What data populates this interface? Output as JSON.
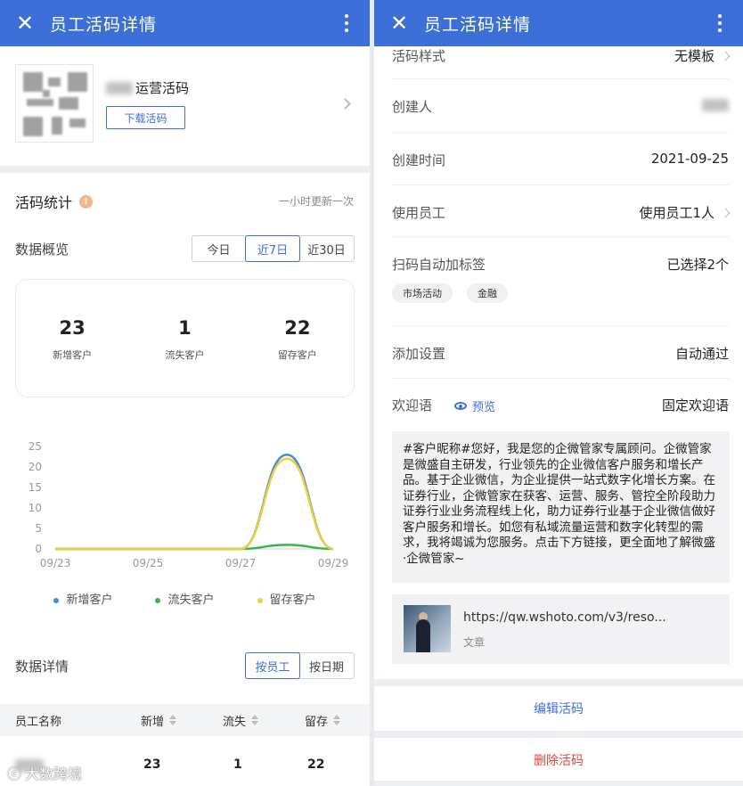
{
  "left": {
    "header": {
      "title": "员工活码详情",
      "close_glyph": "✕"
    },
    "code": {
      "name": "运营活码",
      "download_label": "下载活码"
    },
    "stats": {
      "title": "活码统计",
      "info_glyph": "!",
      "update_note": "一小时更新一次",
      "overview_label": "数据概览",
      "ranges": [
        "今日",
        "近7日",
        "近30日"
      ],
      "active_range": "近7日",
      "metrics": [
        {
          "value": "23",
          "label": "新增客户"
        },
        {
          "value": "1",
          "label": "流失客户"
        },
        {
          "value": "22",
          "label": "留存客户"
        }
      ]
    },
    "chart_data": {
      "type": "line",
      "x": [
        "09/23",
        "09/24",
        "09/25",
        "09/26",
        "09/27",
        "09/28",
        "09/29"
      ],
      "x_tick_labels": [
        "09/23",
        "09/25",
        "09/27",
        "09/29"
      ],
      "yticks": [
        0,
        5,
        10,
        15,
        20,
        25
      ],
      "ylim": [
        0,
        25
      ],
      "smooth": true,
      "series": [
        {
          "name": "新增客户",
          "color": "#3c8fdb",
          "values": [
            0,
            0,
            0,
            0,
            0,
            23,
            0
          ]
        },
        {
          "name": "流失客户",
          "color": "#3ab54a",
          "values": [
            0,
            0,
            0,
            0,
            0,
            1,
            0
          ]
        },
        {
          "name": "留存客户",
          "color": "#f2cc3a",
          "values": [
            0,
            0,
            0,
            0,
            0,
            22,
            0
          ]
        }
      ],
      "legend_position": "bottom"
    },
    "detail": {
      "label": "数据详情",
      "tabs": [
        "按员工",
        "按日期"
      ],
      "active_tab": "按员工",
      "columns": [
        "员工名称",
        "新增",
        "流失",
        "留存"
      ],
      "rows": [
        {
          "new": "23",
          "lost": "1",
          "kept": "22"
        }
      ]
    },
    "watermark": "大数跨境"
  },
  "right": {
    "header": {
      "title": "员工活码详情",
      "close_glyph": "✕"
    },
    "rows": {
      "style": {
        "label": "活码样式",
        "value": "无模板"
      },
      "creator": {
        "label": "创建人"
      },
      "created_at": {
        "label": "创建时间",
        "value": "2021-09-25"
      },
      "staff": {
        "label": "使用员工",
        "value": "使用员工1人"
      },
      "auto_tag": {
        "label": "扫码自动加标签",
        "value": "已选择2个"
      },
      "add_setting": {
        "label": "添加设置",
        "value": "自动通过"
      },
      "welcome": {
        "label": "欢迎语",
        "preview": "预览",
        "value": "固定欢迎语"
      }
    },
    "tags": [
      "市场活动",
      "金融"
    ],
    "welcome_text": "#客户昵称#您好，我是您的企微管家专属顾问。企微管家是微盛自主研发，行业领先的企业微信客户服务和增长产品。基于企业微信，为企业提供一站式数字化增长方案。在证券行业，企微管家在获客、运营、服务、管控全阶段助力证券行业业务流程线上化，助力证券行业基于企业微信做好客户服务和增长。如您有私域流量运营和数字化转型的需求，我将竭诚为您服务。点击下方链接，更全面地了解微盛·企微管家~",
    "link": {
      "url": "https://qw.wshoto.com/v3/reso...",
      "type": "文章"
    },
    "actions": {
      "edit": "编辑活码",
      "delete": "删除活码"
    },
    "colors": {
      "primary": "#3d6fd8",
      "danger": "#e0463a"
    }
  }
}
